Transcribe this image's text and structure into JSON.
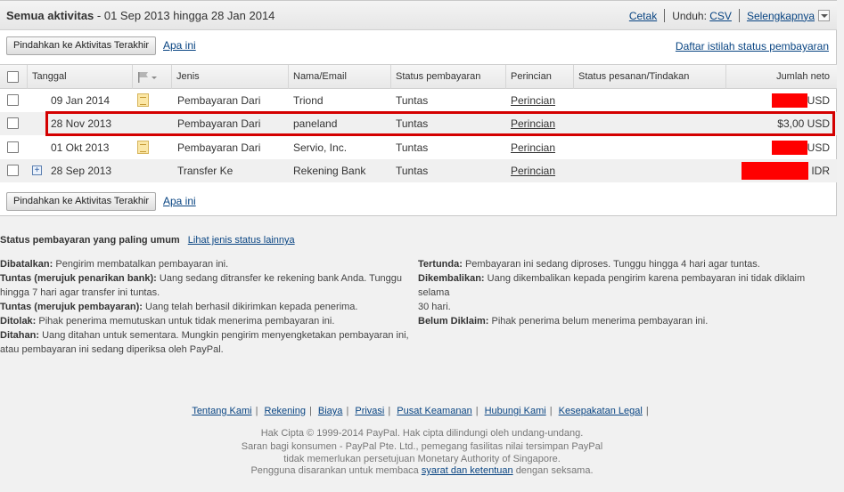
{
  "header": {
    "title": "Semua aktivitas",
    "range": "- 01 Sep 2013 hingga 28 Jan 2014",
    "print": "Cetak",
    "download_label": "Unduh:",
    "csv": "CSV",
    "details": "Selengkapnya"
  },
  "actions": {
    "move_button": "Pindahkan ke Aktivitas Terakhir",
    "whats_this": "Apa ini",
    "glossary": "Daftar istilah status pembayaran"
  },
  "table": {
    "columns": {
      "date": "Tanggal",
      "type": "Jenis",
      "name": "Nama/Email",
      "status": "Status pembayaran",
      "details": "Perincian",
      "order_status": "Status pesanan/Tindakan",
      "amount": "Jumlah neto"
    },
    "rows": [
      {
        "date": "09 Jan 2014",
        "type": "Pembayaran Dari",
        "name": "Triond",
        "status": "Tuntas",
        "details": "Perincian",
        "amount": "USD"
      },
      {
        "date": "28 Nov 2013",
        "type": "Pembayaran Dari",
        "name": "paneland",
        "status": "Tuntas",
        "details": "Perincian",
        "amount": "$3,00 USD"
      },
      {
        "date": "01 Okt 2013",
        "type": "Pembayaran Dari",
        "name": "Servio, Inc.",
        "status": "Tuntas",
        "details": "Perincian",
        "amount": "USD"
      },
      {
        "date": "28 Sep 2013",
        "type": "Transfer Ke",
        "name": "Rekening Bank",
        "status": "Tuntas",
        "details": "Perincian",
        "amount": "IDR"
      }
    ]
  },
  "statuses": {
    "heading": "Status pembayaran yang paling umum",
    "more_link": "Lihat jenis status lainnya",
    "left": [
      {
        "term": "Dibatalkan:",
        "desc": "Pengirim membatalkan pembayaran ini."
      },
      {
        "term": "Tuntas (merujuk penarikan bank):",
        "desc": "Uang sedang ditransfer ke rekening bank Anda. Tunggu",
        "desc2": "hingga 7 hari agar transfer ini tuntas."
      },
      {
        "term": "Tuntas (merujuk pembayaran):",
        "desc": "Uang telah berhasil dikirimkan kepada penerima."
      },
      {
        "term": "Ditolak:",
        "desc": "Pihak penerima memutuskan untuk tidak menerima pembayaran ini."
      },
      {
        "term": "Ditahan:",
        "desc": "Uang ditahan untuk sementara. Mungkin pengirim menyengketakan pembayaran ini,",
        "desc2": "atau pembayaran ini sedang diperiksa oleh PayPal."
      }
    ],
    "right": [
      {
        "term": "Tertunda:",
        "desc": "Pembayaran ini sedang diproses. Tunggu hingga 4 hari agar tuntas."
      },
      {
        "term": "Dikembalikan:",
        "desc": "Uang dikembalikan kepada pengirim karena pembayaran ini tidak diklaim selama",
        "desc2": "30 hari."
      },
      {
        "term": "Belum Diklaim:",
        "desc": "Pihak penerima belum menerima pembayaran ini."
      }
    ]
  },
  "footer": {
    "links": [
      "Tentang Kami",
      "Rekening",
      "Biaya",
      "Privasi",
      "Pusat Keamanan",
      "Hubungi Kami",
      "Kesepakatan Legal"
    ],
    "copyright": "Hak Cipta © 1999-2014 PayPal. Hak cipta dilindungi oleh undang-undang.",
    "notice1": "Saran bagi konsumen - PayPal Pte. Ltd., pemegang fasilitas nilai tersimpan PayPal",
    "notice2": "tidak memerlukan persetujuan Monetary Authority of Singapore.",
    "notice3_pre": "Pengguna disarankan untuk membaca",
    "notice3_link": "syarat dan ketentuan",
    "notice3_post": "dengan seksama."
  },
  "colors": {
    "link": "#084482",
    "highlight": "#d40000",
    "redaction": "#ff0000"
  }
}
